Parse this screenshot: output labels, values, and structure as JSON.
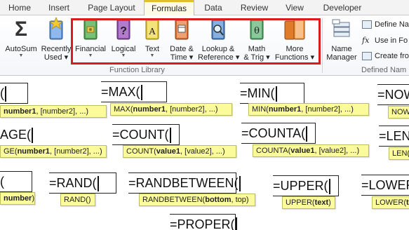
{
  "tabs": [
    {
      "label": "Home"
    },
    {
      "label": "Insert"
    },
    {
      "label": "Page Layout"
    },
    {
      "label": "Formulas",
      "active": true
    },
    {
      "label": "Data"
    },
    {
      "label": "Review"
    },
    {
      "label": "View"
    },
    {
      "label": "Developer"
    }
  ],
  "ribbon": {
    "autosum": {
      "label": "AutoSum",
      "symbol": "Σ"
    },
    "recently_used": {
      "line1": "Recently",
      "line2": "Used"
    },
    "financial": {
      "label": "Financial"
    },
    "logical": {
      "label": "Logical",
      "symbol": "?"
    },
    "text": {
      "label": "Text",
      "symbol": "A"
    },
    "date_time": {
      "line1": "Date &",
      "line2": "Time"
    },
    "lookup": {
      "line1": "Lookup &",
      "line2": "Reference"
    },
    "math": {
      "line1": "Math",
      "line2": "& Trig",
      "symbol": "θ"
    },
    "more": {
      "line1": "More",
      "line2": "Functions"
    },
    "function_library_label": "Function Library",
    "name_manager": {
      "line1": "Name",
      "line2": "Manager"
    },
    "define_name": "Define Na",
    "use_in_formula": "Use in Fo",
    "create_from": "Create fro",
    "defined_names_label": "Defined Nam",
    "colors": {
      "highlight": "#d91c1c",
      "active_tab_accent": "#e2c02a",
      "tooltip_bg": "#fbfb9c"
    }
  },
  "functions": {
    "f1": {
      "text": "(",
      "tip_bold": "number1",
      "tip_rest": ", [number2], ...)",
      "tip_prefix": ""
    },
    "max": {
      "text": "=MAX(",
      "tip_prefix": "MAX(",
      "tip_bold": "number1",
      "tip_rest": ", [number2], ...)"
    },
    "min": {
      "text": "=MIN(",
      "tip_prefix": "MIN(",
      "tip_bold": "number1",
      "tip_rest": ", [number2], ...)"
    },
    "now": {
      "text": "=NOW",
      "tip_prefix": "NOW"
    },
    "average": {
      "text": "AGE(",
      "tip_prefix": "GE(",
      "tip_bold": "number1",
      "tip_rest": ", [number2], ...)"
    },
    "count": {
      "text": "=COUNT(",
      "tip_prefix": "COUNT(",
      "tip_bold": "value1",
      "tip_rest": ", [value2], ...)"
    },
    "counta": {
      "text": "=COUNTA(",
      "tip_prefix": "COUNTA(",
      "tip_bold": "value1",
      "tip_rest": ", [value2], ...)"
    },
    "len": {
      "text": "=LEN",
      "tip_prefix": "LEN("
    },
    "f9": {
      "text": "(",
      "tip_bold": "number",
      "tip_rest": ")"
    },
    "rand": {
      "text": "=RAND(",
      "tip_prefix": "RAND()"
    },
    "randbetween": {
      "text": "=RANDBETWEEN(",
      "tip_prefix": "RANDBETWEEN(",
      "tip_bold": "bottom",
      "tip_rest": ", top)"
    },
    "upper": {
      "text": "=UPPER(",
      "tip_prefix": "UPPER(",
      "tip_bold": "text",
      "tip_rest": ")"
    },
    "lower": {
      "text": "=LOWER",
      "tip_prefix": "LOWER(",
      "tip_bold": "te"
    },
    "proper": {
      "text": "=PROPER("
    }
  }
}
